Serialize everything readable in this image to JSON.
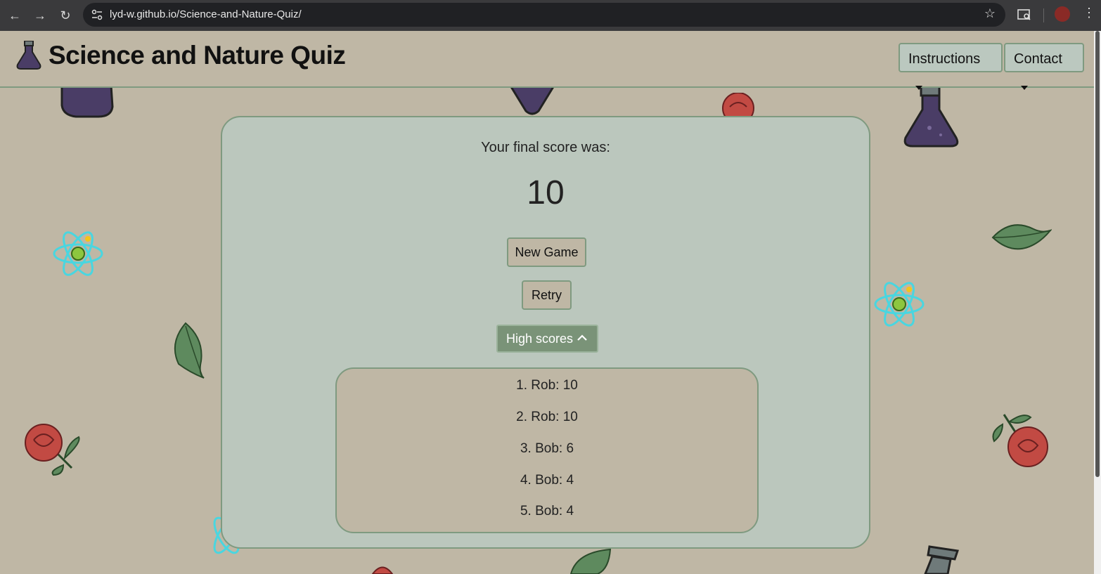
{
  "browser": {
    "url": "lyd-w.github.io/Science-and-Nature-Quiz/",
    "back_icon": "back-arrow-icon",
    "forward_icon": "forward-arrow-icon",
    "reload_icon": "reload-icon"
  },
  "header": {
    "title": "Science and Nature Quiz",
    "logo_icon": "flask-icon",
    "nav": {
      "instructions_label": "Instructions",
      "contact_label": "Contact"
    }
  },
  "results": {
    "final_label": "Your final score was:",
    "final_score": "10",
    "new_game_label": "New Game",
    "retry_label": "Retry",
    "high_scores_label": "High scores",
    "high_scores": [
      "1. Rob: 10",
      "2. Rob: 10",
      "3. Bob: 6",
      "4. Bob: 4",
      "5. Bob: 4"
    ]
  },
  "colors": {
    "page_bg": "#bfb7a5",
    "card_bg": "#bbc7bd",
    "accent_green": "#7a9378",
    "border_green": "#7f9a80"
  }
}
